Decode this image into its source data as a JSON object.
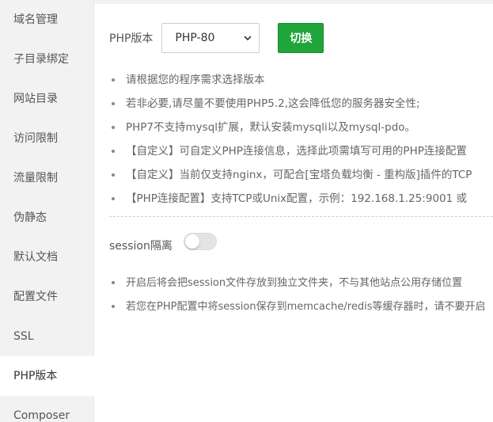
{
  "sidebar": {
    "items": [
      {
        "label": "域名管理"
      },
      {
        "label": "子目录绑定"
      },
      {
        "label": "网站目录"
      },
      {
        "label": "访问限制"
      },
      {
        "label": "流量限制"
      },
      {
        "label": "伪静态"
      },
      {
        "label": "默认文档"
      },
      {
        "label": "配置文件"
      },
      {
        "label": "SSL"
      },
      {
        "label": "PHP版本",
        "active": true
      },
      {
        "label": "Composer"
      }
    ]
  },
  "php": {
    "label": "PHP版本",
    "selected_version": "PHP-80",
    "switch_button": "切换"
  },
  "tips": [
    "请根据您的程序需求选择版本",
    "若非必要,请尽量不要使用PHP5.2,这会降低您的服务器安全性;",
    "PHP7不支持mysql扩展，默认安装mysqli以及mysql-pdo。",
    "【自定义】可自定义PHP连接信息，选择此项需填写可用的PHP连接配置",
    "【自定义】当前仅支持nginx，可配合[宝塔负载均衡 - 重构版]插件的TCP",
    "【PHP连接配置】支持TCP或Unix配置，示例：192.168.1.25:9001 或"
  ],
  "session": {
    "label": "session隔离",
    "enabled": false,
    "tips": [
      "开启后将会把session文件存放到独立文件夹，不与其他站点公用存储位置",
      "若您在PHP配置中将session保存到memcache/redis等缓存器时，请不要开启"
    ]
  },
  "colors": {
    "accent": "#20a53a",
    "sidebar_bg": "#f2f2f2"
  },
  "icons": {
    "select_arrow": "chevron-down-icon"
  }
}
